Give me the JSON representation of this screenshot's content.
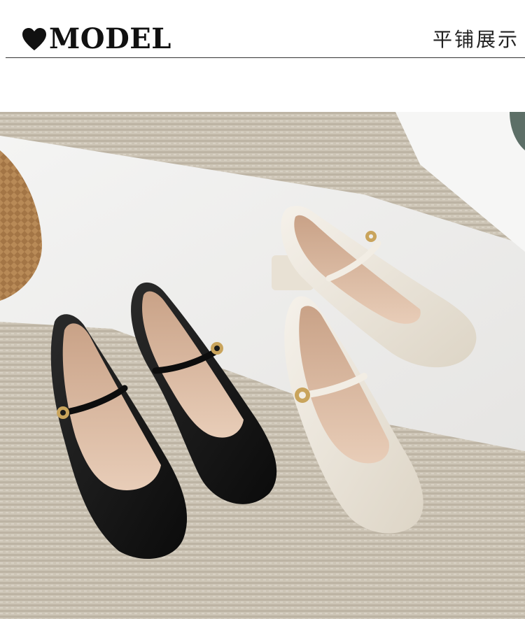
{
  "header": {
    "title": "MODEL",
    "subtitle": "平铺展示",
    "heart_icon": "heart-icon"
  },
  "photo": {
    "subject": "shoes-photo",
    "colors": {
      "black_shoe": "#151515",
      "cream_shoe": "#ece6da",
      "lining": "#dcb9a0",
      "rug": "#c9c1b2",
      "paper": "#f1f0ee",
      "buckle": "#c9a45c"
    }
  }
}
